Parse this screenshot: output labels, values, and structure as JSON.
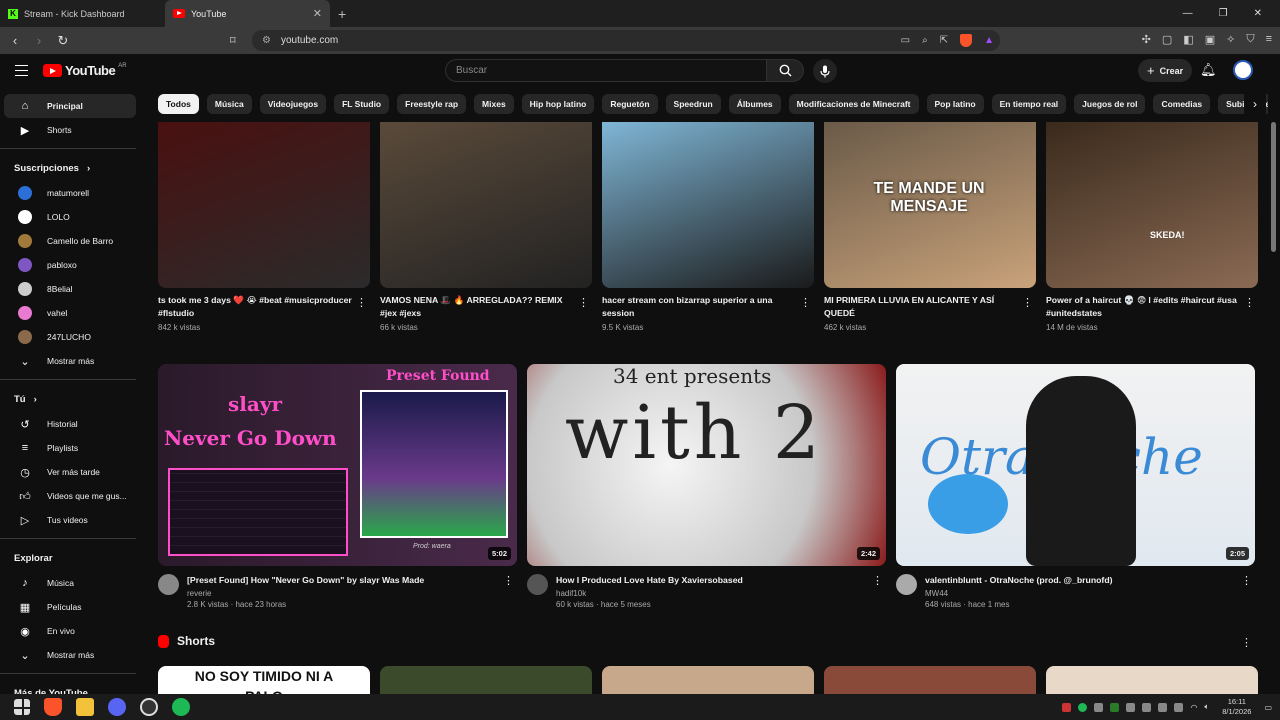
{
  "browser": {
    "tabs": [
      {
        "title": "Stream - Kick Dashboard",
        "icon": "kick-icon",
        "active": false
      },
      {
        "title": "YouTube",
        "icon": "youtube-icon",
        "active": true
      }
    ],
    "url": "youtube.com"
  },
  "header": {
    "logo_text": "YouTube",
    "logo_region": "AR",
    "search_placeholder": "Buscar",
    "create_label": "Crear"
  },
  "chips": [
    "Todos",
    "Música",
    "Videojuegos",
    "FL Studio",
    "Freestyle rap",
    "Mixes",
    "Hip hop latino",
    "Reguetón",
    "Speedrun",
    "Álbumes",
    "Modificaciones de Minecraft",
    "Pop latino",
    "En tiempo real",
    "Juegos de rol",
    "Comedias",
    "Subidos recientemente"
  ],
  "sidebar": {
    "main": [
      {
        "label": "Principal",
        "icon": "home-icon",
        "active": true
      },
      {
        "label": "Shorts",
        "icon": "shorts-icon",
        "active": false
      }
    ],
    "subs_title": "Suscripciones",
    "subs": [
      {
        "label": "matumorell",
        "color": "#2c6fd6"
      },
      {
        "label": "LOLO",
        "color": "#ffffff"
      },
      {
        "label": "Camello de Barro",
        "color": "#a07a3a"
      },
      {
        "label": "pabloxo",
        "color": "#7e57c2"
      },
      {
        "label": "8Belial",
        "color": "#cccccc"
      },
      {
        "label": "vahel",
        "color": "#e87ad0"
      },
      {
        "label": "247LUCHO",
        "color": "#8a6a4a"
      }
    ],
    "subs_more": "Mostrar más",
    "you_title": "Tú",
    "you": [
      {
        "label": "Historial",
        "icon": "history-icon"
      },
      {
        "label": "Playlists",
        "icon": "playlist-icon"
      },
      {
        "label": "Ver más tarde",
        "icon": "clock-icon"
      },
      {
        "label": "Videos que me gus...",
        "icon": "like-icon"
      },
      {
        "label": "Tus videos",
        "icon": "video-icon"
      }
    ],
    "explore_title": "Explorar",
    "explore": [
      {
        "label": "Música",
        "icon": "music-icon"
      },
      {
        "label": "Películas",
        "icon": "film-icon"
      },
      {
        "label": "En vivo",
        "icon": "live-icon"
      },
      {
        "label": "Mostrar más",
        "icon": "chevron-down-icon"
      }
    ],
    "more_title": "Más de YouTube"
  },
  "row1": [
    {
      "title": "ts took me 3 days ❤️ 😭 #beat #musicproducer #flstudio",
      "views": "842 k vistas",
      "colors": [
        "#4a1010",
        "#2b2b2b"
      ]
    },
    {
      "title": "VAMOS NENA 🎩 🔥 ARREGLADA?? REMIX #jex #jexs",
      "views": "66 k vistas",
      "colors": [
        "#5a4a3a",
        "#222"
      ]
    },
    {
      "title": "hacer stream con bizarrap superior a una session",
      "views": "9.5 K vistas",
      "colors": [
        "#7fb6d6",
        "#1a1a1a"
      ]
    },
    {
      "title": "MI PRIMERA LLUVIA EN ALICANTE Y ASÍ QUEDÉ",
      "views": "462 k vistas",
      "colors": [
        "#6a5a48",
        "#c9a27a"
      ]
    },
    {
      "title": "Power of a haircut 💀 😨 l #edits #haircut #usa #unitedstates",
      "views": "14 M de vistas",
      "colors": [
        "#3a2a1c",
        "#8a6a54"
      ]
    }
  ],
  "row1_overlay": "TE MANDE UN MENSAJE",
  "row1_overlay2": "SKEDA!",
  "row2": [
    {
      "title": "[Preset Found] How \"Never Go Down\" by slayr Was Made",
      "channel": "reverie",
      "meta": "2.8 K vistas · hace 23 horas",
      "duration": "5:02",
      "overlay_top": "Preset Found",
      "overlay_a": "slayr",
      "overlay_b": "Never Go Down",
      "overlay_c": "Prod: waera",
      "avatar": "#888888"
    },
    {
      "title": "How I Produced Love Hate By Xaviersobased",
      "channel": "hadif10k",
      "meta": "60 k vistas · hace 5 meses",
      "duration": "2:42",
      "overlay_top": "34 ent presents",
      "overlay_a": "with 2",
      "avatar": "#555555"
    },
    {
      "title": "valentinbluntt - OtraNoche (prod. @_brunofd)",
      "channel": "MW44",
      "meta": "648 vistas · hace 1 mes",
      "duration": "2:05",
      "overlay_a": "Otra noche",
      "avatar": "#aaaaaa"
    }
  ],
  "shorts_title": "Shorts",
  "shorts_overlay": "NO SOY TIMIDO NI A PALO",
  "taskbar": {
    "time": "16:11",
    "date": "8/1/2026"
  }
}
